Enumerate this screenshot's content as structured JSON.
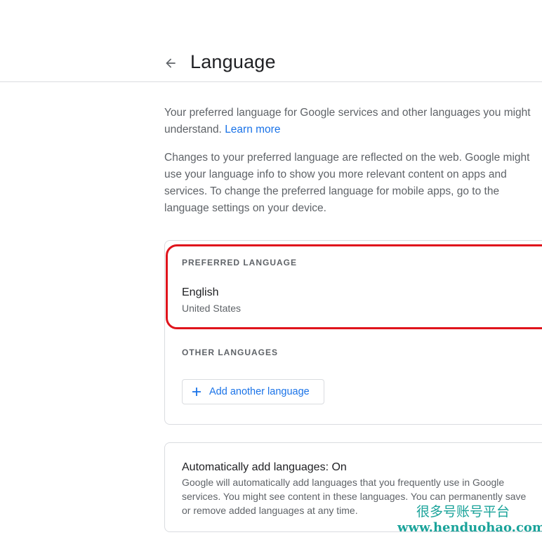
{
  "header": {
    "title": "Language",
    "back_icon": "arrow-left-icon"
  },
  "intro": {
    "text": "Your preferred language for Google services and other languages you might understand.",
    "link": "Learn more"
  },
  "description": "Changes to your preferred language are reflected on the web. Google might use your language info to show you more relevant content on apps and services. To change the preferred language for mobile apps, go to the language settings on your device.",
  "preferred": {
    "label": "PREFERRED LANGUAGE",
    "language": "English",
    "region": "United States"
  },
  "other": {
    "label": "OTHER LANGUAGES",
    "add_button": "Add another language",
    "add_icon": "plus-icon"
  },
  "auto_add": {
    "title": "Automatically add languages: On",
    "description": "Google will automatically add languages that you frequently use in Google services. You might see content in these languages. You can permanently save or remove added languages at any time."
  },
  "watermark": {
    "line1": "很多号账号平台",
    "line2": "www.henduohao.com"
  },
  "colors": {
    "accent": "#1a73e8",
    "highlight": "#e0141c",
    "watermark": "#1aa39a"
  }
}
